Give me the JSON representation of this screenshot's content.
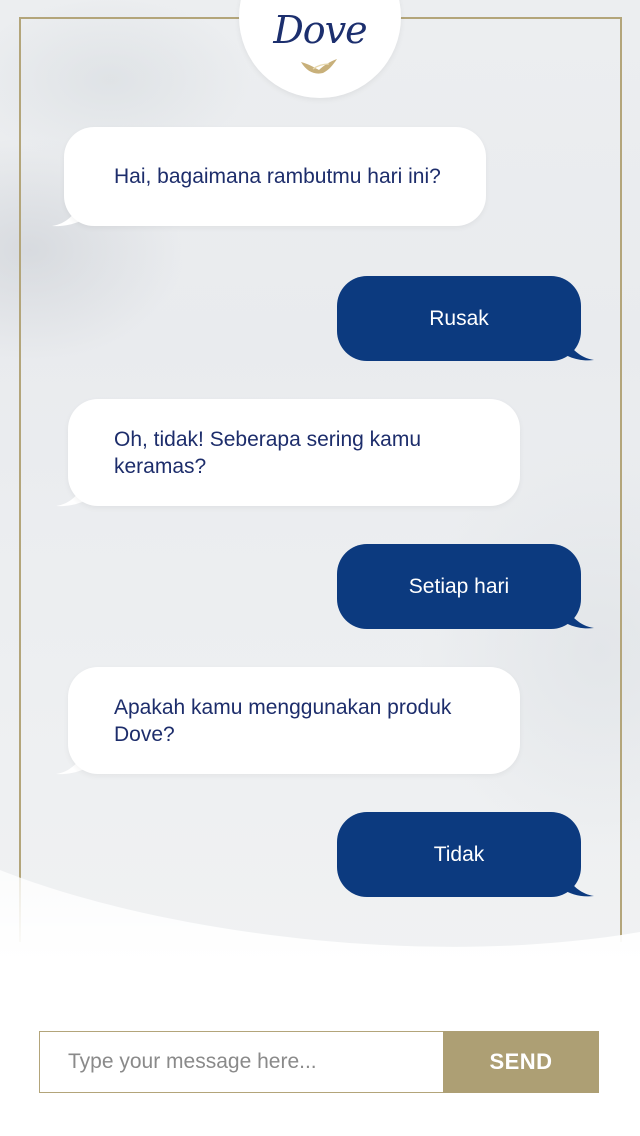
{
  "brand": {
    "name": "Dove",
    "logo_icon": "dove-bird-icon"
  },
  "colors": {
    "brand_navy": "#0c3a7f",
    "gold": "#ad9f74",
    "incoming_text": "#1d2d6b"
  },
  "messages": [
    {
      "from": "bot",
      "text": "Hai, bagaimana rambutmu hari ini?"
    },
    {
      "from": "user",
      "text": "Rusak"
    },
    {
      "from": "bot",
      "text": "Oh, tidak! Seberapa sering kamu keramas?"
    },
    {
      "from": "user",
      "text": "Setiap hari"
    },
    {
      "from": "bot",
      "text": "Apakah kamu menggunakan produk Dove?"
    },
    {
      "from": "user",
      "text": "Tidak"
    }
  ],
  "composer": {
    "placeholder": "Type your message here...",
    "send_label": "SEND"
  }
}
